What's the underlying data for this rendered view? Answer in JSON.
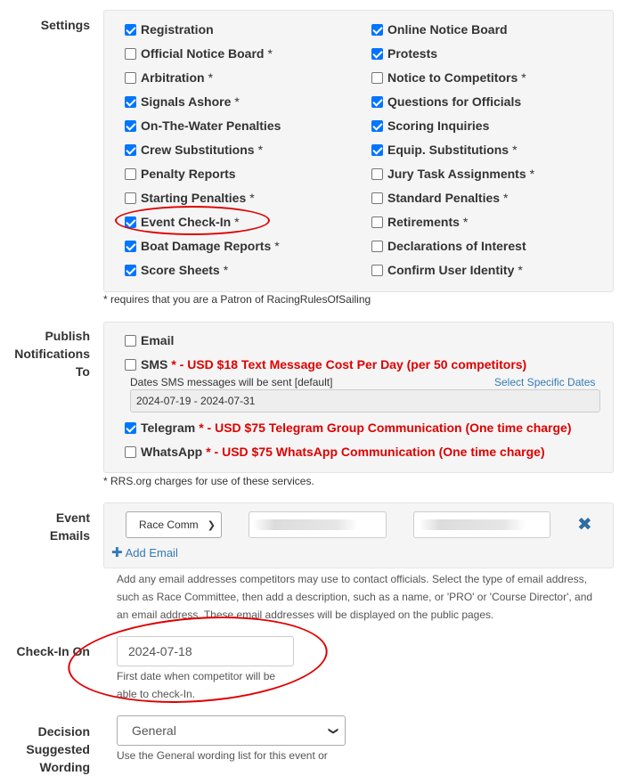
{
  "settings": {
    "label": "Settings",
    "left": [
      {
        "label": "Registration",
        "checked": true,
        "star": false
      },
      {
        "label": "Official Notice Board",
        "checked": false,
        "star": true
      },
      {
        "label": "Arbitration",
        "checked": false,
        "star": true
      },
      {
        "label": "Signals Ashore",
        "checked": true,
        "star": true
      },
      {
        "label": "On-The-Water Penalties",
        "checked": true,
        "star": false
      },
      {
        "label": "Crew Substitutions",
        "checked": true,
        "star": true
      },
      {
        "label": "Penalty Reports",
        "checked": false,
        "star": false
      },
      {
        "label": "Starting Penalties",
        "checked": false,
        "star": true
      },
      {
        "label": "Event Check-In",
        "checked": true,
        "star": true
      },
      {
        "label": "Boat Damage Reports",
        "checked": true,
        "star": true
      },
      {
        "label": "Score Sheets",
        "checked": true,
        "star": true
      }
    ],
    "right": [
      {
        "label": "Online Notice Board",
        "checked": true,
        "star": false
      },
      {
        "label": "Protests",
        "checked": true,
        "star": false
      },
      {
        "label": "Notice to Competitors",
        "checked": false,
        "star": true
      },
      {
        "label": "Questions for Officials",
        "checked": true,
        "star": false
      },
      {
        "label": "Scoring Inquiries",
        "checked": true,
        "star": false
      },
      {
        "label": "Equip. Substitutions",
        "checked": true,
        "star": true
      },
      {
        "label": "Jury Task Assignments",
        "checked": false,
        "star": true
      },
      {
        "label": "Standard Penalties",
        "checked": false,
        "star": true
      },
      {
        "label": "Retirements",
        "checked": false,
        "star": true
      },
      {
        "label": "Declarations of Interest",
        "checked": false,
        "star": false
      },
      {
        "label": "Confirm User Identity",
        "checked": false,
        "star": true
      }
    ],
    "star_mark": "*",
    "footnote": "* requires that you are a Patron of RacingRulesOfSailing"
  },
  "publish": {
    "label_lines": [
      "Publish",
      "Notifications",
      "To"
    ],
    "email": {
      "label": "Email",
      "checked": false
    },
    "sms": {
      "label": "SMS",
      "checked": false,
      "cost": "* - USD $18 Text Message Cost Per Day (per 50 competitors)"
    },
    "sms_dates_label": "Dates SMS messages will be sent [default]",
    "sms_dates_link": "Select Specific Dates",
    "sms_dates_value": "2024-07-19 - 2024-07-31",
    "telegram": {
      "label": "Telegram",
      "checked": true,
      "cost": "* - USD $75 Telegram Group Communication (One time charge)"
    },
    "whatsapp": {
      "label": "WhatsApp",
      "checked": false,
      "cost": "* - USD $75 WhatsApp Communication (One time charge)"
    },
    "footnote": "* RRS.org charges for use of these services."
  },
  "event_emails": {
    "label_lines": [
      "Event",
      "Emails"
    ],
    "type_select": "Race Comm",
    "add_label": "Add Email",
    "help": "Add any email addresses competitors may use to contact officials. Select the type of email address, such as Race Committee, then add a description, such as a name, or 'PRO' or 'Course Director', and an email address. These email addresses will be displayed on the public pages."
  },
  "checkin": {
    "label": "Check-In On",
    "value": "2024-07-18",
    "help": "First date when competitor will be able to check-In."
  },
  "decision": {
    "label_lines": [
      "Decision",
      "Suggested",
      "Wording"
    ],
    "select": "General",
    "help": "Use the General wording list for this event or"
  },
  "colors": {
    "accent": "#0075ff",
    "cost_red": "#e00000",
    "link": "#337ab7",
    "annotation": "#e00000"
  }
}
